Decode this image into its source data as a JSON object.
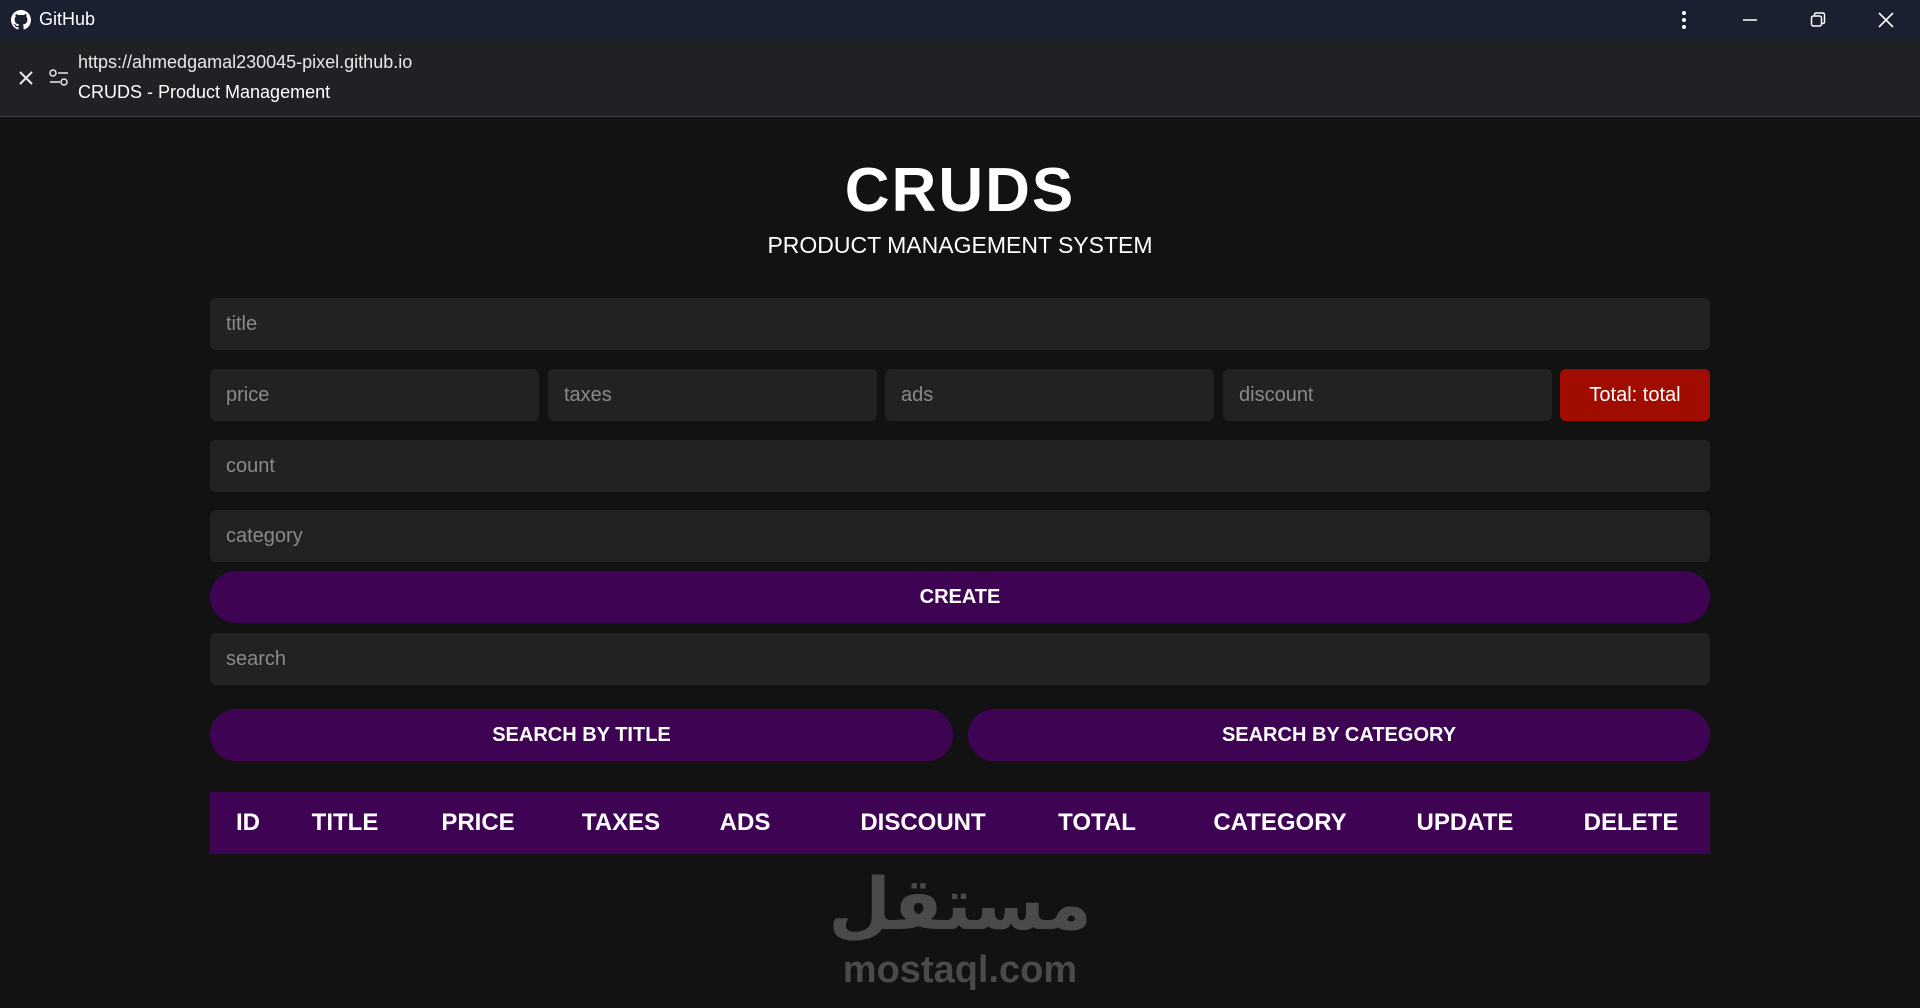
{
  "titlebar": {
    "app_name": "GitHub",
    "icons": [
      "github-icon",
      "more-vert-icon",
      "minimize-icon",
      "restore-icon",
      "close-icon"
    ]
  },
  "addressbar": {
    "url": "https://ahmedgamal230045-pixel.github.io",
    "page_title": "CRUDS - Product Management",
    "icons": [
      "close-icon",
      "tune-icon"
    ]
  },
  "page": {
    "title": "CRUDS",
    "subtitle": "PRODUCT MANAGEMENT SYSTEM"
  },
  "form": {
    "title_placeholder": "title",
    "price_placeholder": "price",
    "taxes_placeholder": "taxes",
    "ads_placeholder": "ads",
    "discount_placeholder": "discount",
    "total_label": "Total: total",
    "count_placeholder": "count",
    "category_placeholder": "category",
    "create_label": "CREATE"
  },
  "search": {
    "placeholder": "search",
    "by_title_label": "SEARCH BY TITLE",
    "by_category_label": "SEARCH BY CATEGORY"
  },
  "table": {
    "headers": [
      "ID",
      "TITLE",
      "PRICE",
      "TAXES",
      "ADS",
      "DISCOUNT",
      "TOTAL",
      "CATEGORY",
      "UPDATE",
      "DELETE"
    ],
    "rows": []
  },
  "watermark": {
    "arabic": "مستقل",
    "latin": "mostaql.com"
  },
  "colors": {
    "background": "#121212",
    "input_bg": "#222222",
    "accent_purple": "#3e0453",
    "total_red": "#a10c00",
    "titlebar": "#1b2030"
  }
}
